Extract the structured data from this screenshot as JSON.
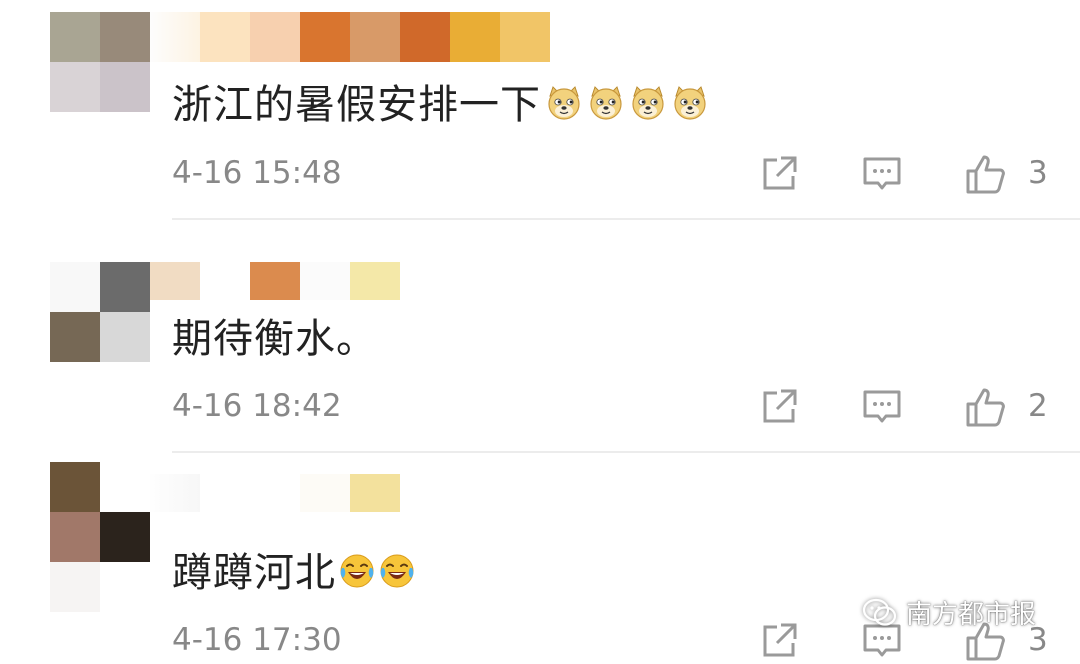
{
  "comments": [
    {
      "text": "浙江的暑假安排一下",
      "emoji_count": 4,
      "emoji": "doge-icon",
      "time": "4-16 15:48",
      "likes": "3"
    },
    {
      "text": "期待衡水。",
      "emoji_count": 0,
      "time": "4-16 18:42",
      "likes": "2"
    },
    {
      "text": "蹲蹲河北",
      "emoji_count": 2,
      "emoji": "laugh-cry-icon",
      "time": "4-16 17:30",
      "likes": "3"
    }
  ],
  "watermark": {
    "label": "南方都市报",
    "icon": "wechat-icon"
  },
  "colors": {
    "text": "#222222",
    "meta": "#888888",
    "icon": "#9a9a9a",
    "divider": "#ececec"
  }
}
